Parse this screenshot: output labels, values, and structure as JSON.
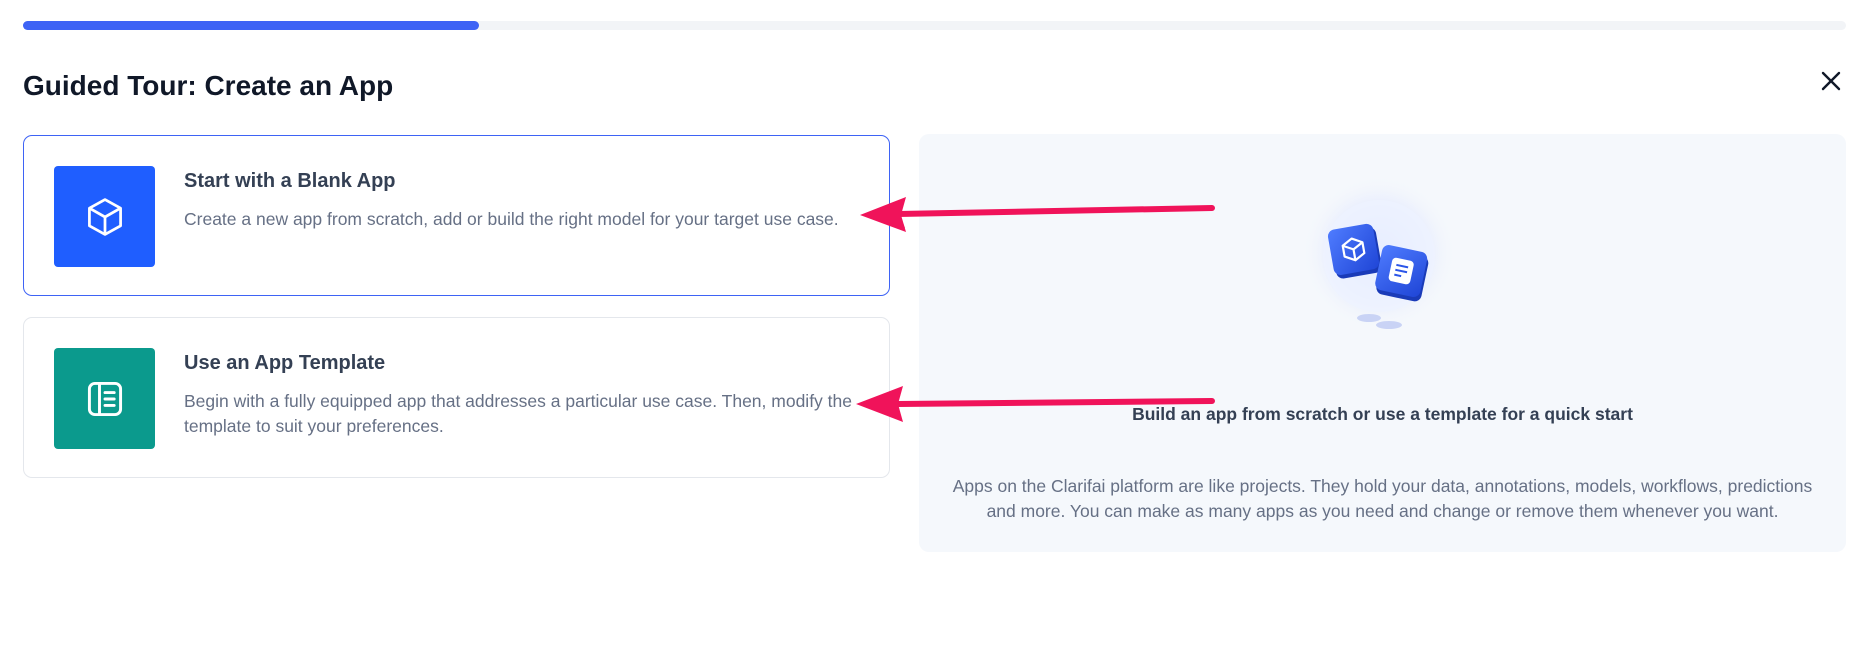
{
  "progress": {
    "value_percent": 25
  },
  "header": {
    "title": "Guided Tour: Create an App",
    "close_icon": "close-icon"
  },
  "options": [
    {
      "title": "Start with a Blank App",
      "description": "Create a new app from scratch, add or build the right model for your target use case.",
      "icon": "cube-icon",
      "icon_bg": "#1f5eff",
      "selected": true
    },
    {
      "title": "Use an App Template",
      "description": "Begin with a fully equipped app that addresses a particular use case. Then, modify the template to suit your preferences.",
      "icon": "template-icon",
      "icon_bg": "#0b9a8d",
      "selected": false
    }
  ],
  "info_panel": {
    "heading": "Build an app from scratch or use a template for a quick start",
    "body": "Apps on the Clarifai platform are like projects. They hold your data, annotations, models, workflows, predictions and more. You can make as many apps as you need and change or remove them whenever you want.",
    "illustration_icon": "apps-illustration-icon"
  },
  "colors": {
    "accent": "#3e63f5",
    "annotation_arrow": "#f0135a"
  }
}
